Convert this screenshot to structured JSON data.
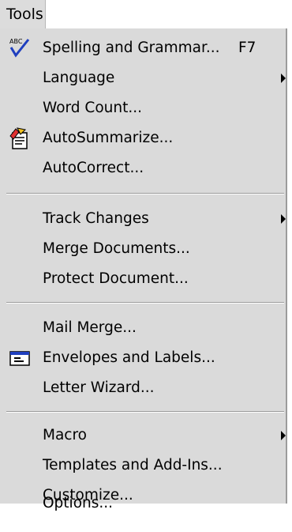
{
  "menubar": {
    "title": "Tools"
  },
  "menu": {
    "items": [
      {
        "label": "Spelling and Grammar...",
        "shortcut": "F7"
      },
      {
        "label": "Language"
      },
      {
        "label": "Word Count..."
      },
      {
        "label": "AutoSummarize..."
      },
      {
        "label": "AutoCorrect..."
      },
      {
        "label": "Track Changes"
      },
      {
        "label": "Merge Documents..."
      },
      {
        "label": "Protect Document..."
      },
      {
        "label": "Mail Merge..."
      },
      {
        "label": "Envelopes and Labels..."
      },
      {
        "label": "Letter Wizard..."
      },
      {
        "label": "Macro"
      },
      {
        "label": "Templates and Add-Ins..."
      },
      {
        "label": "Customize..."
      },
      {
        "label": "Options..."
      }
    ]
  },
  "icons": {
    "spelling": "spelling-check-icon",
    "autosummarize": "autosummarize-icon",
    "envelopes": "envelope-label-icon",
    "submenu": "submenu-arrow-icon"
  }
}
